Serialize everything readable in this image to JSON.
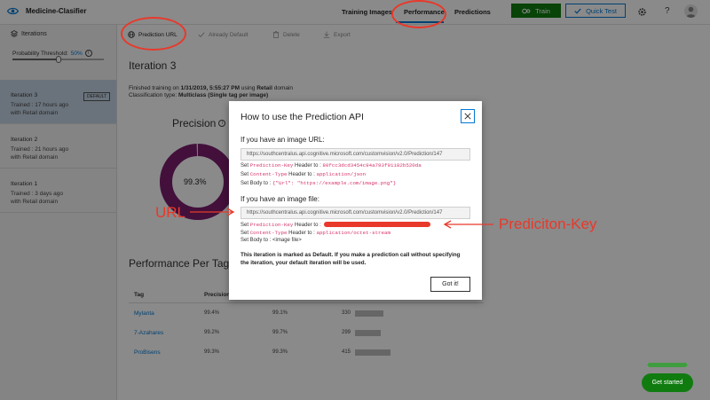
{
  "header": {
    "app_title": "Medicine-Clasifier",
    "nav": {
      "training": "Training Images",
      "performance": "Performance",
      "predictions": "Predictions"
    },
    "train_label": "Train",
    "quick_test_label": "Quick Test",
    "help_glyph": "?",
    "icons": [
      "eye-icon",
      "gear-icon",
      "avatar-icon"
    ]
  },
  "toolbar": {
    "prediction_url": "Prediction URL",
    "already_default": "Already Default",
    "delete": "Delete",
    "export": "Export"
  },
  "sidebar": {
    "header": "Iterations",
    "threshold_label": "Probability Threshold:",
    "threshold_value": "50%",
    "threshold_fraction": 0.5,
    "iterations": [
      {
        "name": "Iteration 3",
        "badge": "DEFAULT",
        "trained": "Trained : 17 hours ago",
        "domain": "with Retail domain"
      },
      {
        "name": "Iteration 2",
        "trained": "Trained : 21 hours ago",
        "domain": "with Retail domain"
      },
      {
        "name": "Iteration 1",
        "trained": "Trained : 3 days ago",
        "domain": "with Retail domain"
      }
    ]
  },
  "main": {
    "iteration_title": "Iteration 3",
    "trained_prefix": "Finished training on ",
    "trained_date": "1/31/2019, 5:55:27 PM",
    "trained_using": " using ",
    "trained_domain": "Retail",
    "trained_suffix": " domain",
    "classification_prefix": "Classification type: ",
    "classification_value": "Multiclass (Single tag per image)",
    "precision_label": "Precision",
    "precision_value": "99.3%",
    "precision_fraction": 0.993,
    "perf_per_tag": "Performance Per Tag",
    "table": {
      "headers": {
        "tag": "Tag",
        "precision": "Precision"
      },
      "rows": [
        {
          "tag": "Mylanta",
          "precision": "99.4%",
          "recall": "99.1%",
          "count": "330",
          "count_num": 330
        },
        {
          "tag": "7-Azahares",
          "precision": "99.2%",
          "recall": "99.7%",
          "count": "299",
          "count_num": 299
        },
        {
          "tag": "ProBisens",
          "precision": "99.3%",
          "recall": "99.3%",
          "count": "415",
          "count_num": 415
        }
      ]
    }
  },
  "modal": {
    "title": "How to use the Prediction API",
    "url_section_label": "If you have an image URL:",
    "url_value": "https://southcentralus.api.cognitive.microsoft.com/customvision/v2.0/Prediction/147",
    "url_set_key_prefix": "Set ",
    "key_name": "Prediction-Key",
    "header_to": " Header to : ",
    "key_value": "80fcc3dcd3454c94a793f91182b520da",
    "content_type_name": "Content-Type",
    "content_type_json": "application/json",
    "set_body_to": "Set Body to : ",
    "body_json": "{\"Url\": \"https://example.com/image.png\"}",
    "file_section_label": "If you have an image file:",
    "file_url_value": "https://southcentralus.api.cognitive.microsoft.com/customvision/v2.0/Prediction/147",
    "content_type_octet": "application/octet-stream",
    "body_file": "<image file>",
    "set_word": "Set ",
    "default_note": "This iteration is marked as Default. If you make a prediction call without specifying the iteration, your default iteration will be used.",
    "got_it": "Got it!"
  },
  "annotations": {
    "url_label": "URL",
    "key_label": "Prediciton-Key",
    "color": "#e8392a"
  },
  "bottom": {
    "get_started": "Get started",
    "progress_fraction": 1.0
  },
  "colors": {
    "brand_green": "#107c10",
    "accent_blue": "#0078d4",
    "donut_purple": "#7a1f6e",
    "selected_iteration": "#c5d5e6"
  }
}
